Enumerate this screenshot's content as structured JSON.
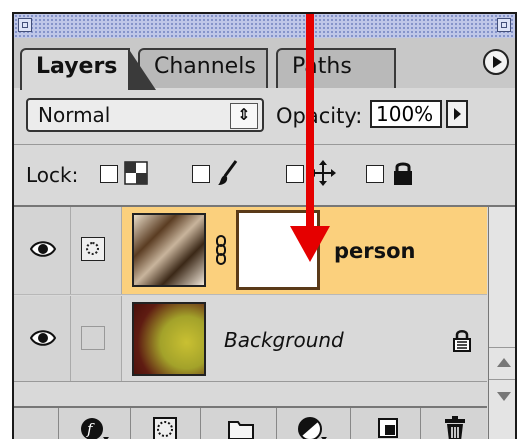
{
  "tabs": [
    {
      "label": "Layers",
      "active": true
    },
    {
      "label": "Channels",
      "active": false
    },
    {
      "label": "Paths",
      "active": false
    }
  ],
  "blend": {
    "mode": "Normal",
    "opacity_label": "Opacity:",
    "opacity_value": "100%"
  },
  "lock": {
    "label": "Lock:"
  },
  "layers": [
    {
      "name": "person",
      "selected": true,
      "has_mask": true
    },
    {
      "name": "Background",
      "selected": false,
      "locked": true
    }
  ],
  "colors": {
    "selected_row": "#fbd07d",
    "arrow": "#e50000",
    "panel": "#d9d9d9"
  },
  "icons": [
    "eye-icon",
    "layer-mask-indicator-icon",
    "link-chain-icon",
    "padlock-icon",
    "layer-style-icon",
    "add-mask-icon",
    "new-set-icon",
    "adjustment-layer-icon",
    "new-layer-icon",
    "trash-icon",
    "panel-menu-icon"
  ]
}
